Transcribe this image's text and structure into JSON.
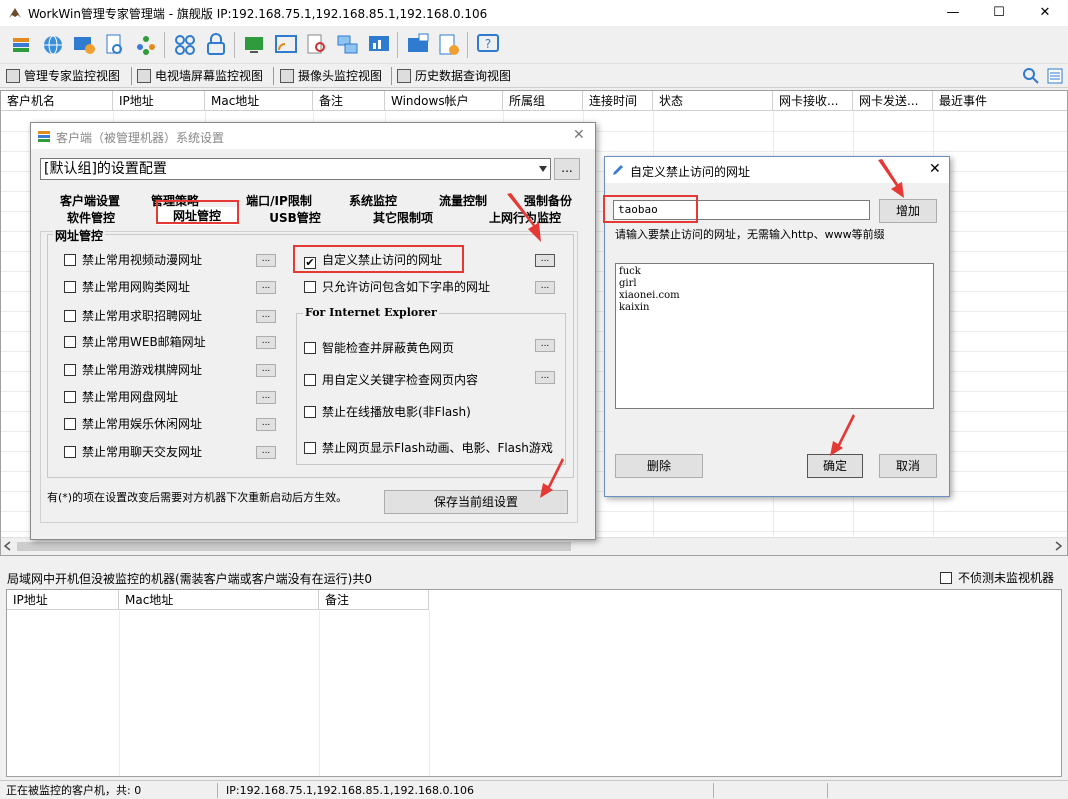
{
  "window": {
    "title": "WorkWin管理专家管理端 - 旗舰版 IP:192.168.75.1,192.168.85.1,192.168.0.106",
    "minimize": "—",
    "maximize": "☐",
    "close": "✕"
  },
  "view_tabs": [
    {
      "label": "管理专家监控视图",
      "icon": "monitor-view-icon"
    },
    {
      "label": "电视墙屏幕监控视图",
      "icon": "tv-wall-icon"
    },
    {
      "label": "摄像头监控视图",
      "icon": "camera-icon"
    },
    {
      "label": "历史数据查询视图",
      "icon": "history-icon"
    }
  ],
  "main_columns": [
    "客户机名",
    "IP地址",
    "Mac地址",
    "备注",
    "Windows帐户",
    "所属组",
    "连接时间",
    "状态",
    "网卡接收...",
    "网卡发送...",
    "最近事件"
  ],
  "lower": {
    "caption": "局域网中开机但没被监控的机器(需装客户端或客户端没有在运行)共0",
    "no_detect_label": "不侦测未监视机器",
    "columns": [
      "IP地址",
      "Mac地址",
      "备注"
    ]
  },
  "status": {
    "clients": "正在被监控的客户机，共: 0",
    "ip": "IP:192.168.75.1,192.168.85.1,192.168.0.106"
  },
  "settings_dialog": {
    "title": "客户端（被管理机器）系统设置",
    "close": "✕",
    "combo_value": "[默认组]的设置配置",
    "combo_more": "...",
    "tabs_row1": [
      "客户端设置",
      "管理策略",
      "端口/IP限制",
      "系统监控",
      "流量控制",
      "强制备份"
    ],
    "tabs_row2": [
      "软件管控",
      "网址管控",
      "USB管控",
      "其它限制项",
      "上网行为监控"
    ],
    "group_label": "网址管控",
    "left_options": [
      "禁止常用视频动漫网址",
      "禁止常用网购类网址",
      "禁止常用求职招聘网址",
      "禁止常用WEB邮箱网址",
      "禁止常用游戏棋牌网址",
      "禁止常用网盘网址",
      "禁止常用娱乐休闲网址",
      "禁止常用聊天交友网址"
    ],
    "right_options": [
      {
        "label": "自定义禁止访问的网址",
        "checked": "✔"
      },
      {
        "label": "只允许访问包含如下字串的网址",
        "checked": ""
      }
    ],
    "ie_group_label": "For Internet Explorer",
    "ie_options": [
      "智能检查并屏蔽黄色网页",
      "用自定义关键字检查网页内容",
      "禁止在线播放电影(非Flash)",
      "禁止网页显示Flash动画、电影、Flash游戏"
    ],
    "small_btn": "...",
    "note": "有(*)的项在设置改变后需要对方机器下次重新启动后方生效。",
    "save_button": "保存当前组设置"
  },
  "url_dialog": {
    "title": "自定义禁止访问的网址",
    "close": "✕",
    "input_value": "taobao",
    "add_button": "增加",
    "hint": "请输入要禁止访问的网址，无需输入http、www等前缀",
    "urls": [
      "fuck",
      "girl",
      "xiaonei.com",
      "kaixin"
    ],
    "delete_button": "删除",
    "ok_button": "确定",
    "cancel_button": "取消"
  },
  "colors": {
    "highlight_red": "#e53935",
    "arrow_red": "#e53935"
  }
}
